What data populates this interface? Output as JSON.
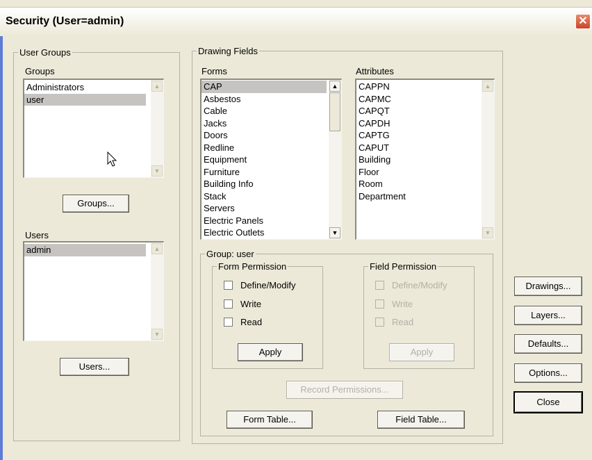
{
  "window": {
    "title": "Security (User=admin)"
  },
  "user_groups": {
    "legend": "User Groups",
    "groups_label": "Groups",
    "groups": [
      "Administrators",
      "user"
    ],
    "groups_selected": 1,
    "groups_button": "Groups...",
    "users_label": "Users",
    "users": [
      "admin"
    ],
    "users_selected": 0,
    "users_button": "Users..."
  },
  "drawing_fields": {
    "legend": "Drawing Fields",
    "forms_label": "Forms",
    "forms": [
      "CAP",
      "Asbestos",
      "Cable",
      "Jacks",
      "Doors",
      "Redline",
      "Equipment",
      "Furniture",
      "Building Info",
      "Stack",
      "Servers",
      "Electric Panels",
      "Electric Outlets"
    ],
    "forms_selected": 0,
    "attributes_label": "Attributes",
    "attributes": [
      "CAPPN",
      "CAPMC",
      "CAPQT",
      "CAPDH",
      "CAPTG",
      "CAPUT",
      "Building",
      "Floor",
      "Room",
      "Department"
    ]
  },
  "group_panel": {
    "legend": "Group: user",
    "form_permission": {
      "legend": "Form Permission",
      "define_modify": "Define/Modify",
      "write": "Write",
      "read": "Read",
      "apply": "Apply"
    },
    "field_permission": {
      "legend": "Field Permission",
      "define_modify": "Define/Modify",
      "write": "Write",
      "read": "Read",
      "apply": "Apply"
    },
    "record_permissions": "Record Permissions...",
    "form_table": "Form Table...",
    "field_table": "Field Table..."
  },
  "side_buttons": {
    "drawings": "Drawings...",
    "layers": "Layers...",
    "defaults": "Defaults...",
    "options": "Options...",
    "close": "Close"
  }
}
